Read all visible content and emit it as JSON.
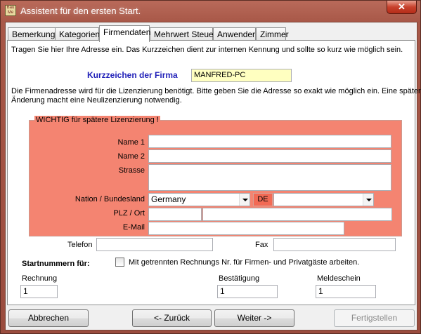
{
  "window": {
    "title": "Assistent für den ersten Start.",
    "close_label": "✕",
    "icon_text": "Bau Me"
  },
  "tabs": [
    {
      "label": "Bemerkung"
    },
    {
      "label": "Kategorien"
    },
    {
      "label": "Firmendaten",
      "active": true
    },
    {
      "label": "Mehrwert Steuer"
    },
    {
      "label": "Anwender"
    },
    {
      "label": "Zimmer"
    }
  ],
  "firmendaten": {
    "intro": "Tragen Sie hier Ihre Adresse ein. Das Kurzzeichen dient zur internen Kennung und sollte so kurz wie möglich sein.",
    "kurzzeichen_label": "Kurzzeichen der Firma",
    "kurzzeichen_value": "MANFRED-PC",
    "info_line1": "Die Firmenadresse wird für die Lizenzierung benötigt. Bitte geben Sie die Adresse so exakt wie möglich ein. Eine spätere",
    "info_line2": "Änderung macht eine Neulizenzierung notwendig.",
    "group_title": "WICHTIG für spätere Lizenzierung !",
    "name1_label": "Name 1",
    "name1_value": "",
    "name2_label": "Name 2",
    "name2_value": "",
    "strasse_label": "Strasse",
    "strasse_value": "",
    "nation_label": "Nation / Bundesland",
    "nation_value": "Germany",
    "country_code": "DE",
    "bundesland_value": "",
    "plz_label": "PLZ / Ort",
    "plz_value": "",
    "ort_value": "",
    "email_label": "E-Mail",
    "email_value": "",
    "telefon_label": "Telefon",
    "telefon_value": "",
    "fax_label": "Fax",
    "fax_value": "",
    "startnummern_label": "Startnummern für:",
    "checkbox_label": "Mit getrennten Rechnungs Nr. für Firmen- und Privatgäste arbeiten.",
    "checkbox_checked": false,
    "rechnung_label": "Rechnung",
    "rechnung_value": "1",
    "bestaetigung_label": "Bestätigung",
    "bestaetigung_value": "1",
    "meldeschein_label": "Meldeschein",
    "meldeschein_value": "1"
  },
  "buttons": {
    "cancel": "Abbrechen",
    "back": "<- Zurück",
    "next": "Weiter ->",
    "finish": "Fertigstellen"
  },
  "colors": {
    "group_bg": "#f48471",
    "title_accent": "#1f1fb8",
    "highlight_input": "#ffffc0"
  }
}
